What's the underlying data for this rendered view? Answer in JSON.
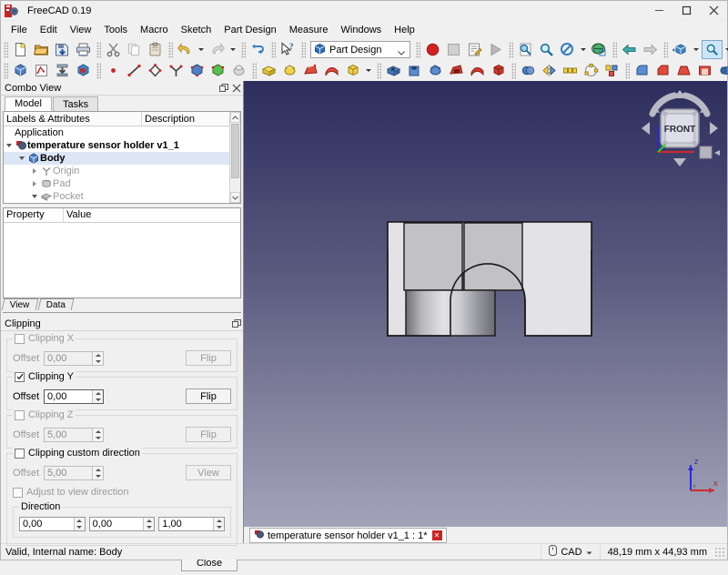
{
  "window": {
    "title": "FreeCAD 0.19",
    "app_icon": "freecad-logo-icon",
    "minimize": "minimize-icon",
    "maximize": "maximize-icon",
    "close": "close-icon"
  },
  "menubar": {
    "items": [
      {
        "label": "File"
      },
      {
        "label": "Edit"
      },
      {
        "label": "View"
      },
      {
        "label": "Tools"
      },
      {
        "label": "Macro"
      },
      {
        "label": "Sketch"
      },
      {
        "label": "Part Design"
      },
      {
        "label": "Measure"
      },
      {
        "label": "Windows"
      },
      {
        "label": "Help"
      }
    ]
  },
  "toolbar": {
    "workbench_selector": {
      "value": "Part Design",
      "icon": "part-design-workbench-icon"
    },
    "row1": [
      {
        "name": "new-document",
        "icon": "new-file"
      },
      {
        "name": "open-document",
        "icon": "open-folder"
      },
      {
        "name": "save-document",
        "icon": "save-disk"
      },
      {
        "name": "print-document",
        "icon": "printer"
      },
      {
        "name": "cut",
        "icon": "scissors"
      },
      {
        "name": "copy",
        "icon": "copy-pages"
      },
      {
        "name": "paste",
        "icon": "clipboard"
      },
      {
        "name": "undo",
        "icon": "undo-arrow"
      },
      {
        "name": "redo",
        "icon": "redo-arrow"
      },
      {
        "name": "refresh",
        "icon": "refresh-arrows"
      },
      {
        "name": "whats-this",
        "icon": "cursor-question"
      }
    ],
    "row1b": [
      {
        "name": "stop-macro",
        "icon": "red-circle-record"
      },
      {
        "name": "macro-stop",
        "icon": "grey-square-stop"
      },
      {
        "name": "macro-edit",
        "icon": "edit-note"
      },
      {
        "name": "macro-execute",
        "icon": "play-triangle"
      },
      {
        "name": "fit-all",
        "icon": "fit-all-magnifier"
      },
      {
        "name": "fit-selection",
        "icon": "magnifier"
      },
      {
        "name": "draw-style",
        "icon": "no-entry-style"
      },
      {
        "name": "draw-style-as-is",
        "icon": "globe-cube"
      },
      {
        "name": "back-view-nav",
        "icon": "left-arrow"
      },
      {
        "name": "forward-view-nav",
        "icon": "right-arrow"
      },
      {
        "name": "std-views",
        "icon": "view-cube-blue"
      },
      {
        "name": "zoom-box",
        "icon": "zoom-magnifier-active"
      },
      {
        "name": "axonometric",
        "icon": "wire-cube"
      },
      {
        "name": "isometric-view",
        "icon": "cyan-cube"
      },
      {
        "name": "view-section",
        "icon": "section-cube"
      }
    ],
    "row2": [
      {
        "name": "create-body",
        "icon": "body-blue"
      },
      {
        "name": "create-sketch",
        "icon": "sketch-red"
      },
      {
        "name": "attach-sketch",
        "icon": "sketch-attach"
      },
      {
        "name": "validate-sketch",
        "icon": "cube-sketch"
      },
      {
        "name": "create-point",
        "icon": "point-red"
      },
      {
        "name": "create-line",
        "icon": "line-red"
      },
      {
        "name": "create-polyline",
        "icon": "polyline-diamond"
      },
      {
        "name": "create-datum",
        "icon": "datum-axis"
      },
      {
        "name": "shape-binder",
        "icon": "shape-binder-blue"
      },
      {
        "name": "sub-object-binder",
        "icon": "sub-binder-green"
      },
      {
        "name": "clone-object",
        "icon": "clone-grey"
      },
      {
        "name": "pad",
        "icon": "pad-yellow"
      },
      {
        "name": "revolution",
        "icon": "revolution-yellow"
      },
      {
        "name": "additive-loft",
        "icon": "loft-red"
      },
      {
        "name": "additive-pipe",
        "icon": "pipe-red"
      },
      {
        "name": "additive-primitive",
        "icon": "primitive-box-yellow"
      },
      {
        "name": "pocket",
        "icon": "pocket-blue"
      },
      {
        "name": "hole",
        "icon": "hole-blue"
      },
      {
        "name": "groove",
        "icon": "groove-blue"
      },
      {
        "name": "subtractive-loft",
        "icon": "sub-loft-red"
      },
      {
        "name": "subtractive-pipe",
        "icon": "sub-pipe-red"
      },
      {
        "name": "subtractive-primitive",
        "icon": "sub-primitive-red"
      },
      {
        "name": "boolean",
        "icon": "boolean-blue"
      },
      {
        "name": "mirrored",
        "icon": "mirror-yellow"
      },
      {
        "name": "linear-pattern",
        "icon": "linear-pattern"
      },
      {
        "name": "polar-pattern",
        "icon": "polar-pattern"
      },
      {
        "name": "multi-transform",
        "icon": "multi-transform"
      },
      {
        "name": "fillet",
        "icon": "fillet-blue"
      },
      {
        "name": "chamfer",
        "icon": "chamfer-red"
      },
      {
        "name": "draft",
        "icon": "draft-red"
      },
      {
        "name": "thickness",
        "icon": "thickness-red"
      },
      {
        "name": "measure-1",
        "icon": "measure-blue"
      },
      {
        "name": "measure-2",
        "icon": "measure-refresh"
      },
      {
        "name": "measure-3",
        "icon": "measure-toggle"
      }
    ]
  },
  "combo_view": {
    "title": "Combo View",
    "float_icon": "undock-icon",
    "close_icon": "close-icon",
    "tabs": [
      {
        "label": "Model",
        "selected": true
      },
      {
        "label": "Tasks",
        "selected": false
      }
    ],
    "tree_headers": {
      "labels": "Labels & Attributes",
      "description": "Description"
    },
    "tree": [
      {
        "label": "Application",
        "depth": 0,
        "expander": "none",
        "icon": "none",
        "state": "normal"
      },
      {
        "label": "temperature sensor holder v1_1",
        "depth": 0,
        "expander": "down",
        "icon": "document-icon",
        "state": "bold"
      },
      {
        "label": "Body",
        "depth": 1,
        "expander": "down",
        "icon": "body-icon",
        "state": "selected"
      },
      {
        "label": "Origin",
        "depth": 2,
        "expander": "right",
        "icon": "origin-icon",
        "state": "hidden"
      },
      {
        "label": "Pad",
        "depth": 2,
        "expander": "right",
        "icon": "pad-icon",
        "state": "hidden"
      },
      {
        "label": "Pocket",
        "depth": 2,
        "expander": "down",
        "icon": "pocket-icon",
        "state": "hidden"
      }
    ],
    "property_headers": {
      "property": "Property",
      "value": "Value"
    },
    "property_rows": [],
    "view_data_tabs": [
      {
        "label": "View"
      },
      {
        "label": "Data"
      }
    ]
  },
  "clipping": {
    "title": "Clipping",
    "float_icon": "undock-icon",
    "groups": [
      {
        "name": "clipping-x",
        "label": "Clipping X",
        "checked": false,
        "enabled": false,
        "offset_label": "Offset",
        "offset_value": "0,00",
        "button_label": "Flip"
      },
      {
        "name": "clipping-y",
        "label": "Clipping Y",
        "checked": true,
        "enabled": true,
        "offset_label": "Offset",
        "offset_value": "0,00",
        "button_label": "Flip"
      },
      {
        "name": "clipping-z",
        "label": "Clipping Z",
        "checked": false,
        "enabled": false,
        "offset_label": "Offset",
        "offset_value": "5,00",
        "button_label": "Flip"
      }
    ],
    "custom": {
      "label": "Clipping custom direction",
      "checked": false,
      "offset_label": "Offset",
      "offset_value": "5,00",
      "button_label": "View",
      "adjust_label": "Adjust to view direction",
      "adjust_checked": false,
      "direction_label": "Direction",
      "direction_values": [
        "0,00",
        "0,00",
        "1,00"
      ]
    },
    "close_label": "Close"
  },
  "viewport": {
    "navcube_face": "FRONT",
    "axis_labels": {
      "x": "X",
      "y": "Y",
      "z": "Z"
    },
    "document_tab": {
      "label": "temperature sensor holder v1_1 : 1*",
      "icon": "freecad-logo-icon",
      "close_icon": "tab-close-icon"
    }
  },
  "statusbar": {
    "message": "Valid, Internal name: Body",
    "nav_style": "CAD",
    "nav_icon": "navigation-icon",
    "dimensions": "48,19 mm x 44,93 mm"
  }
}
